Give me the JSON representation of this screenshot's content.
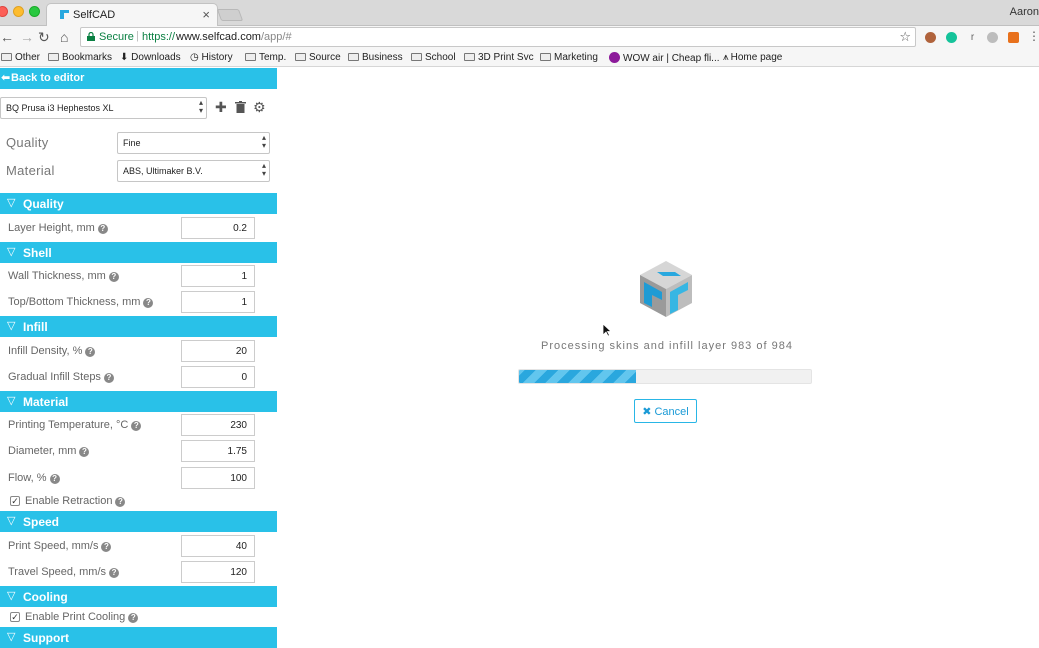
{
  "browser": {
    "tab_title": "SelfCAD",
    "profile_name": "Aaron",
    "url_secure": "Secure",
    "url_scheme": "https://",
    "url_host": "www.selfcad.com",
    "url_path": "/app/#",
    "bookmarks": [
      "Other",
      "Bookmarks",
      "Downloads",
      "History",
      "Temp.",
      "Source",
      "Business",
      "School",
      "3D Print Svc",
      "Marketing",
      "WOW air | Cheap fli...",
      "Home page"
    ]
  },
  "sidebar": {
    "back_label": "Back to editor",
    "printer": "BQ Prusa i3 Hephestos XL",
    "quality_label": "Quality",
    "quality_value": "Fine",
    "material_label": "Material",
    "material_value": "ABS, Ultimaker B.V.",
    "sections": {
      "quality": "Quality",
      "shell": "Shell",
      "infill": "Infill",
      "material": "Material",
      "speed": "Speed",
      "cooling": "Cooling",
      "support": "Support"
    },
    "fields": {
      "layer_height": {
        "label": "Layer Height, mm",
        "value": "0.2"
      },
      "wall_thickness": {
        "label": "Wall Thickness, mm",
        "value": "1"
      },
      "top_bottom": {
        "label": "Top/Bottom Thickness, mm",
        "value": "1"
      },
      "infill_density": {
        "label": "Infill Density, %",
        "value": "20"
      },
      "gradual_infill": {
        "label": "Gradual Infill Steps",
        "value": "0"
      },
      "print_temp": {
        "label": "Printing Temperature, °C",
        "value": "230"
      },
      "diameter": {
        "label": "Diameter, mm",
        "value": "1.75"
      },
      "flow": {
        "label": "Flow, %",
        "value": "100"
      },
      "print_speed": {
        "label": "Print Speed, mm/s",
        "value": "40"
      },
      "travel_speed": {
        "label": "Travel Speed, mm/s",
        "value": "120"
      }
    },
    "enable_retraction": "Enable Retraction",
    "enable_cooling": "Enable Print Cooling"
  },
  "main": {
    "status_text": "Processing skins and infill layer 983 of 984",
    "progress": 0.4,
    "cancel_label": "Cancel"
  },
  "colors": {
    "accent": "#29c1e8",
    "progress": "#2aa7de"
  }
}
